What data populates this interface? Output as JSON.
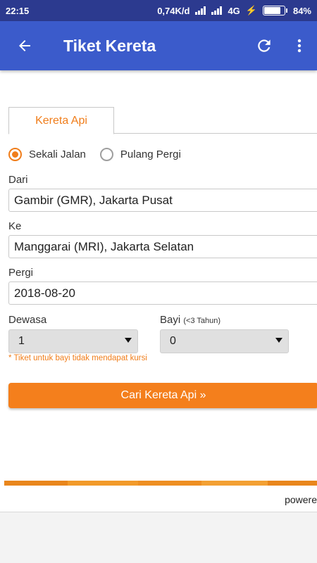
{
  "status_bar": {
    "time": "22:15",
    "network_speed": "0,74K/d",
    "network_type": "4G",
    "battery": "84%",
    "battery_level": 0.84
  },
  "app_bar": {
    "title": "Tiket Kereta",
    "back_icon": "arrow-left-icon",
    "refresh_icon": "refresh-icon",
    "menu_icon": "more-vert-icon"
  },
  "tabs": [
    {
      "label": "Kereta Api",
      "active": true
    }
  ],
  "trip_type": {
    "options": [
      {
        "label": "Sekali Jalan",
        "selected": true
      },
      {
        "label": "Pulang Pergi",
        "selected": false
      }
    ]
  },
  "form": {
    "from_label": "Dari",
    "from_value": "Gambir (GMR), Jakarta Pusat",
    "to_label": "Ke",
    "to_value": "Manggarai (MRI), Jakarta Selatan",
    "depart_label": "Pergi",
    "depart_value": "2018-08-20",
    "adult_label": "Dewasa",
    "adult_value": "1",
    "infant_label": "Bayi",
    "infant_hint": "(<3 Tahun)",
    "infant_value": "0",
    "infant_note": "* Tiket untuk bayi tidak mendapat kursi",
    "search_button": "Cari Kereta Api »"
  },
  "footer": {
    "powered_text": "powere"
  },
  "colors": {
    "status_bar": "#2c3a8f",
    "app_bar": "#3b5bcb",
    "accent": "#f07d1a",
    "button": "#f47f1c"
  }
}
